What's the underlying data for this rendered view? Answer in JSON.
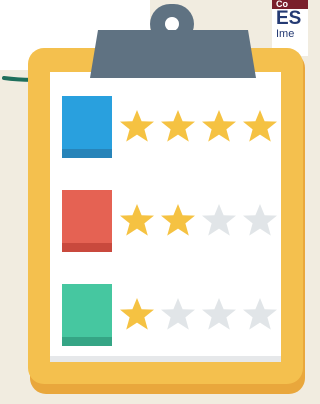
{
  "logo": {
    "top_text": "Co",
    "main_text": "ES",
    "sub_text": "Ime"
  },
  "colors": {
    "background": "#f1ece0",
    "board": "#f4c04e",
    "board_shadow": "#e9a73c",
    "paper": "#ffffff",
    "clip": "#5f7282",
    "star_filled": "#f5c242",
    "star_empty": "#e1e5e8",
    "curve": "#1f6f5c"
  },
  "items": [
    {
      "icon": "book-icon",
      "cover_color": "#29a0de",
      "spine_color": "#2784b9",
      "rating": 4,
      "max": 4
    },
    {
      "icon": "book-icon",
      "cover_color": "#e56253",
      "spine_color": "#c9493d",
      "rating": 2,
      "max": 4
    },
    {
      "icon": "book-icon",
      "cover_color": "#46c7a0",
      "spine_color": "#35a585",
      "rating": 1,
      "max": 4
    }
  ]
}
